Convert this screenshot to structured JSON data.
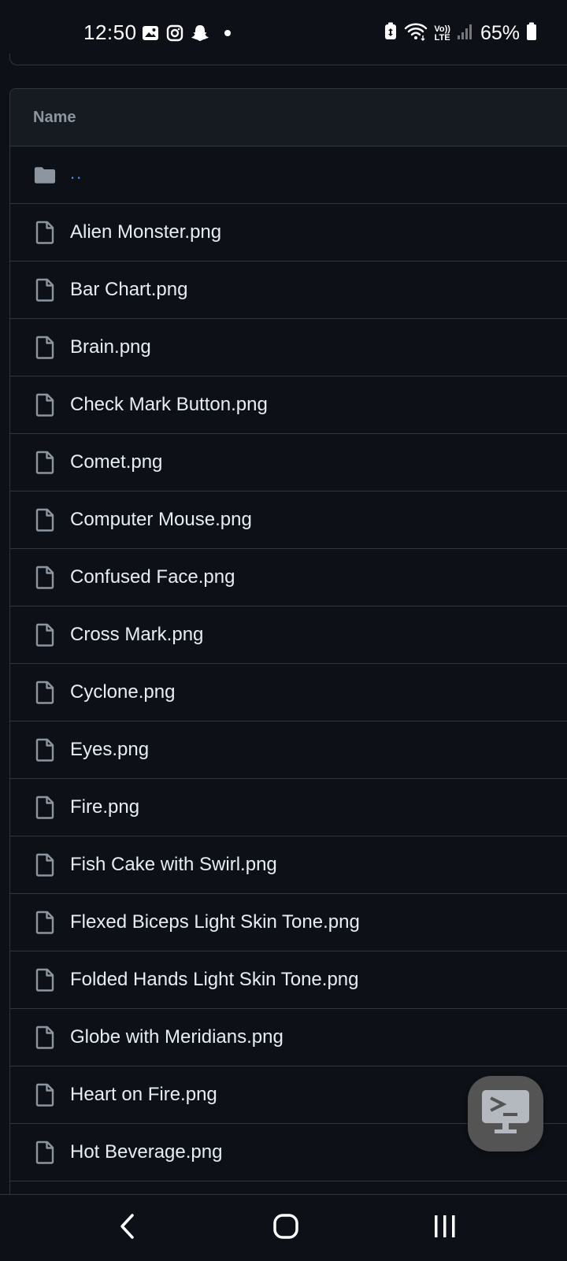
{
  "status_bar": {
    "time": "12:50",
    "battery_percent": "65%",
    "left_icons": [
      "gallery-icon",
      "instagram-icon",
      "snapchat-icon",
      "notification-dot"
    ],
    "right_icons": [
      "battery-saver-icon",
      "wifi-icon",
      "volte-icon",
      "signal-icon",
      "battery-icon"
    ],
    "volte_label_top": "Vo))",
    "volte_label_bottom": "LTE"
  },
  "file_list": {
    "header": "Name",
    "parent_dir": "..",
    "files": [
      "Alien Monster.png",
      "Bar Chart.png",
      "Brain.png",
      "Check Mark Button.png",
      "Comet.png",
      "Computer Mouse.png",
      "Confused Face.png",
      "Cross Mark.png",
      "Cyclone.png",
      "Eyes.png",
      "Fire.png",
      "Fish Cake with Swirl.png",
      "Flexed Biceps Light Skin Tone.png",
      "Folded Hands Light Skin Tone.png",
      "Globe with Meridians.png",
      "Heart on Fire.png",
      "Hot Beverage.png"
    ]
  },
  "floating_button": {
    "icon": "terminal-monitor-icon"
  },
  "nav_bar": {
    "buttons": [
      "back-icon",
      "home-icon",
      "recents-icon"
    ]
  },
  "colors": {
    "background": "#0d1117",
    "header_bg": "#161b22",
    "border": "#30363d",
    "text": "#e6edf3",
    "muted": "#8d96a0",
    "link": "#4493f8"
  }
}
